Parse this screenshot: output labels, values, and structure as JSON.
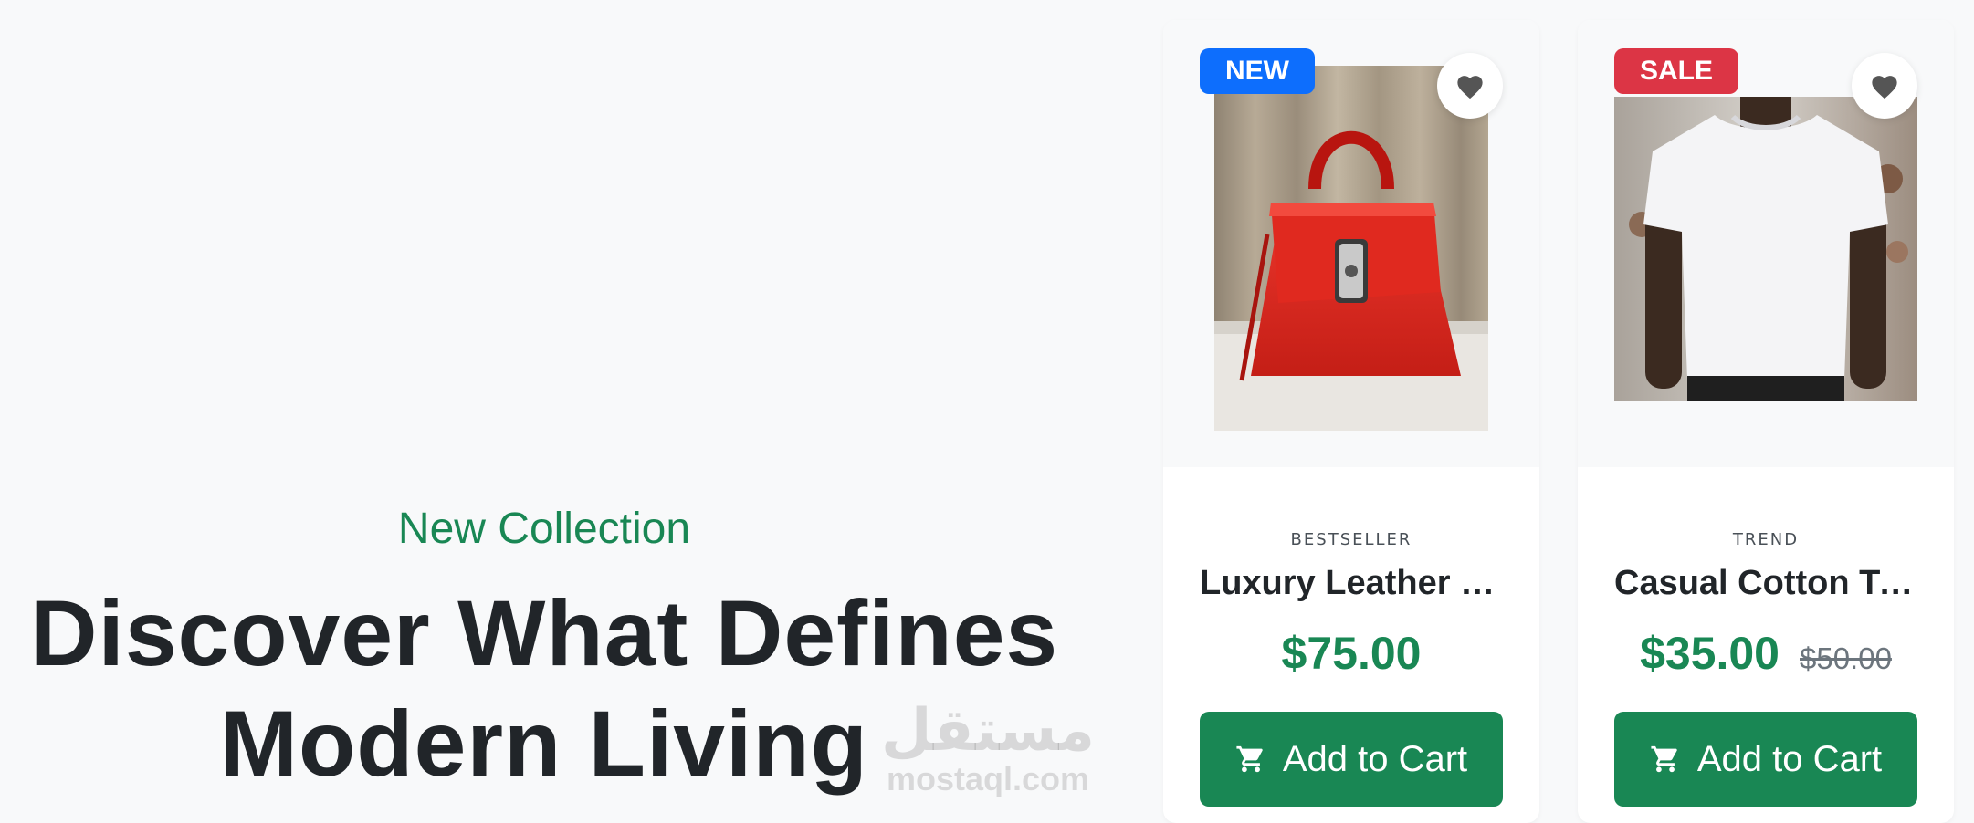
{
  "hero": {
    "subtitle": "New Collection",
    "title_line1": "Discover What Defines",
    "title_line2": "Modern Living"
  },
  "watermark": {
    "arabic": "مستقل",
    "latin": "mostaql.com"
  },
  "products": [
    {
      "badge": "NEW",
      "badge_color": "#0d6efd",
      "category": "BESTSELLER",
      "name": "Luxury Leather Handbag",
      "price": "$75.00",
      "old_price": "",
      "button_label": "Add to Cart",
      "image": "red-handbag",
      "favorite_icon": "heart-icon"
    },
    {
      "badge": "SALE",
      "badge_color": "#dc3545",
      "category": "TREND",
      "name": "Casual Cotton T-Shirt",
      "price": "$35.00",
      "old_price": "$50.00",
      "button_label": "Add to Cart",
      "image": "white-t-shirt",
      "favorite_icon": "heart-icon"
    }
  ],
  "colors": {
    "accent": "#198754",
    "badge_new": "#0d6efd",
    "badge_sale": "#dc3545",
    "background": "#f8f9fa",
    "text": "#212529"
  }
}
